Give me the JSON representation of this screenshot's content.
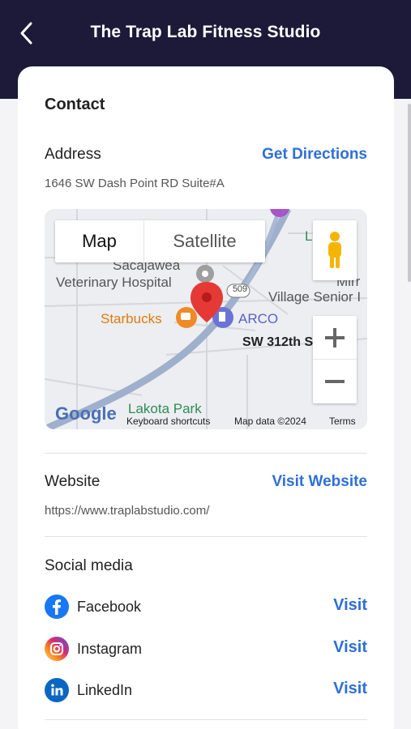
{
  "header": {
    "title": "The Trap Lab Fitness Studio"
  },
  "contact": {
    "title": "Contact",
    "address_label": "Address",
    "get_directions": "Get Directions",
    "address": "1646 SW Dash Point RD Suite#A",
    "map": {
      "type_map": "Map",
      "type_satellite": "Satellite",
      "labels": {
        "sacajawea": "Sacajawea",
        "veterinary": "Veterinary Hospital",
        "starbucks": "Starbucks",
        "arco": "ARCO",
        "village": "Village Senior I",
        "street": "SW 312th S",
        "route": "509",
        "lakota": "Lakota Park",
        "google": "Google",
        "partial_top": "L",
        "partial_mirr": "Mirr"
      },
      "footer": {
        "shortcuts": "Keyboard shortcuts",
        "data": "Map data ©2024",
        "terms": "Terms"
      }
    },
    "website_label": "Website",
    "visit_website": "Visit Website",
    "website_url": "https://www.traplabstudio.com/",
    "social_title": "Social media",
    "social": [
      {
        "name": "Facebook",
        "action": "Visit",
        "icon": "facebook-icon"
      },
      {
        "name": "Instagram",
        "action": "Visit",
        "icon": "instagram-icon"
      },
      {
        "name": "LinkedIn",
        "action": "Visit",
        "icon": "linkedin-icon"
      }
    ]
  },
  "colors": {
    "header_bg": "#1c1a38",
    "link": "#2d6fd8",
    "pin": "#e53935"
  }
}
